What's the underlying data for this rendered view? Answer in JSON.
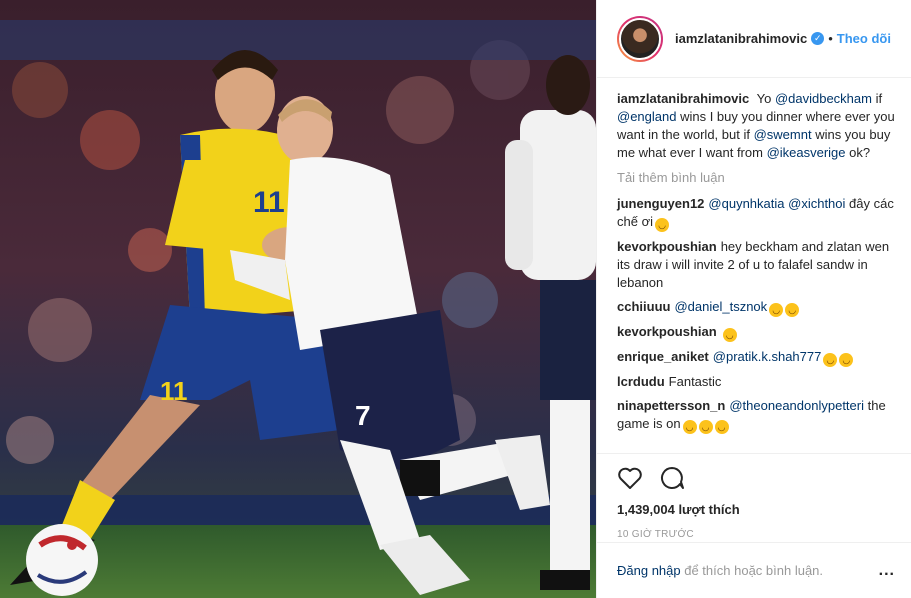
{
  "post": {
    "username": "iamzlatanibrahimovic",
    "follow_label": "Theo dõi",
    "dot": "•",
    "verified_icon": "✓"
  },
  "caption": {
    "user": "iamzlatanibrahimovic",
    "segments": [
      {
        "text": "Yo ",
        "mention": false
      },
      {
        "text": "@davidbeckham",
        "mention": true
      },
      {
        "text": " if ",
        "mention": false
      },
      {
        "text": "@england",
        "mention": true
      },
      {
        "text": " wins I buy you dinner where ever you want in the world, but if ",
        "mention": false
      },
      {
        "text": "@swemnt",
        "mention": true
      },
      {
        "text": " wins you buy me what ever I want from ",
        "mention": false
      },
      {
        "text": "@ikeasverige",
        "mention": true
      },
      {
        "text": " ok?",
        "mention": false
      }
    ]
  },
  "load_more": "Tải thêm bình luận",
  "comments": [
    {
      "user": "junenguyen12",
      "segments": [
        {
          "text": "@quynhkatia",
          "mention": true
        },
        {
          "text": " ",
          "mention": false
        },
        {
          "text": "@xichthoi",
          "mention": true
        },
        {
          "text": " đây các chế ơi",
          "mention": false
        }
      ],
      "emojis": 1
    },
    {
      "user": "kevorkpoushian",
      "segments": [
        {
          "text": "hey beckham and zlatan wen its draw i will invite 2 of u to falafel sandw in lebanon",
          "mention": false
        }
      ],
      "emojis": 0
    },
    {
      "user": "cchiiuuu",
      "segments": [
        {
          "text": "@daniel_tsznok",
          "mention": true
        }
      ],
      "emojis": 2
    },
    {
      "user": "kevorkpoushian",
      "segments": [],
      "emojis": 1
    },
    {
      "user": "enrique_aniket",
      "segments": [
        {
          "text": "@pratik.k.shah777",
          "mention": true
        }
      ],
      "emojis": 2
    },
    {
      "user": "lcrdudu",
      "segments": [
        {
          "text": "Fantastic",
          "mention": false
        }
      ],
      "emojis": 0
    },
    {
      "user": "ninapettersson_n",
      "segments": [
        {
          "text": "@theoneandonlypetteri",
          "mention": true
        },
        {
          "text": " the game is on",
          "mention": false
        }
      ],
      "emojis": 3
    }
  ],
  "likes": "1,439,004 lượt thích",
  "time": "10 GIỜ TRƯỚC",
  "footer": {
    "login_link": "Đăng nhập",
    "login_rest": " để thích hoặc bình luận.",
    "more": "..."
  },
  "photo": {
    "left_jersey_number": "11",
    "right_jersey_number": "7",
    "shorts_number": "11"
  },
  "colors": {
    "accent": "#3897f0",
    "mention": "#003569",
    "muted": "#999999",
    "sweden_yellow": "#f2d21a",
    "sweden_blue": "#1d3f8f"
  },
  "icons": [
    "heart-icon",
    "comment-icon",
    "verified-icon",
    "more-options-icon"
  ]
}
